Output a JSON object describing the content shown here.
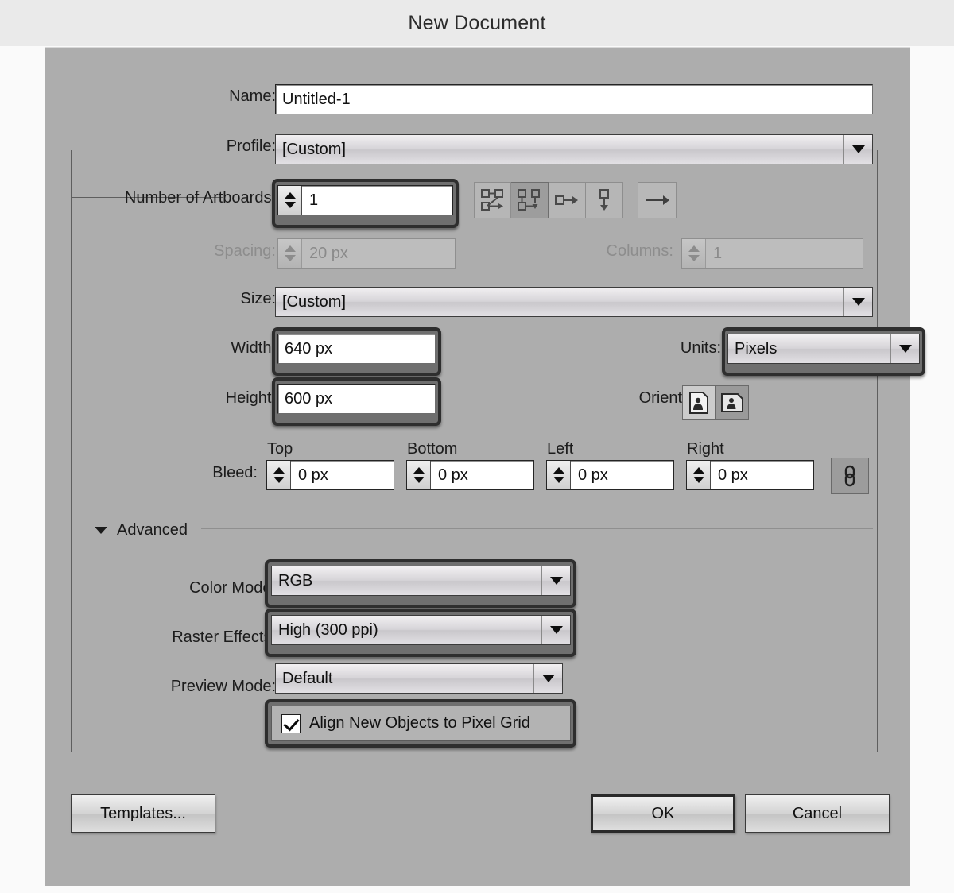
{
  "window": {
    "title": "New Document"
  },
  "fields": {
    "name_label": "Name:",
    "name_value": "Untitled-1",
    "profile_label": "Profile:",
    "profile_value": "[Custom]",
    "artboards_label": "Number of Artboards:",
    "artboards_value": "1",
    "spacing_label": "Spacing:",
    "spacing_value": "20 px",
    "columns_label": "Columns:",
    "columns_value": "1",
    "size_label": "Size:",
    "size_value": "[Custom]",
    "width_label": "Width:",
    "width_value": "640 px",
    "height_label": "Height:",
    "height_value": "600 px",
    "units_label": "Units:",
    "units_value": "Pixels",
    "orientation_label": "Orientation:",
    "bleed_label": "Bleed:",
    "bleed_top_caption": "Top",
    "bleed_top_value": "0 px",
    "bleed_bottom_caption": "Bottom",
    "bleed_bottom_value": "0 px",
    "bleed_left_caption": "Left",
    "bleed_left_value": "0 px",
    "bleed_right_caption": "Right",
    "bleed_right_value": "0 px"
  },
  "advanced": {
    "section_label": "Advanced",
    "color_mode_label": "Color Mode:",
    "color_mode_value": "RGB",
    "raster_label": "Raster Effects:",
    "raster_value": "High (300 ppi)",
    "preview_label": "Preview Mode:",
    "preview_value": "Default",
    "align_pixel_grid_label": "Align New Objects to Pixel Grid",
    "align_pixel_grid_checked": "true"
  },
  "buttons": {
    "templates": "Templates...",
    "ok": "OK",
    "cancel": "Cancel"
  },
  "icons": {
    "artboard_grid_rows": "grid-by-row-icon",
    "artboard_grid_cols": "grid-by-column-icon",
    "artboard_row": "arrange-by-row-icon",
    "artboard_col": "arrange-by-column-icon",
    "artboard_rtl": "right-to-left-layout-icon",
    "orientation_portrait": "portrait-icon",
    "orientation_landscape": "landscape-icon",
    "bleed_link": "link-chain-icon"
  },
  "colors": {
    "dialog_bg": "#adadad",
    "titlebar_bg": "#eaeaea",
    "page_bg": "#fafafa",
    "focus_ring": "#2e2e2e",
    "input_bg": "#ffffff"
  }
}
